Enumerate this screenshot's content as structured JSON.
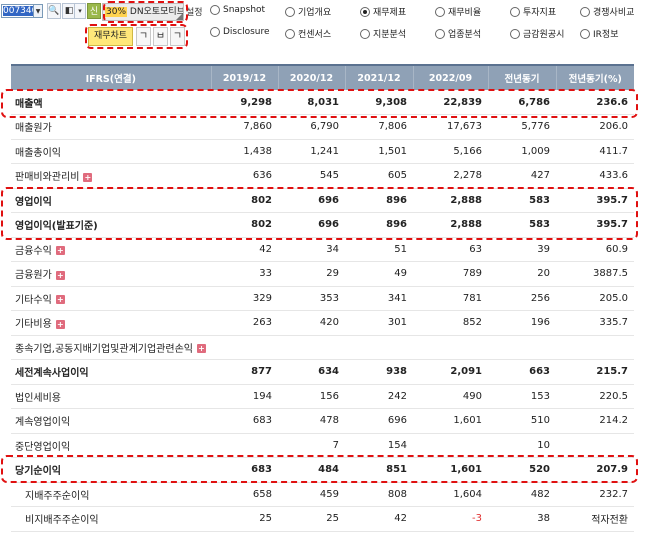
{
  "toolbar": {
    "stock_code": "007340",
    "zoom_pct": "30%",
    "stock_name": "DN오토모티브",
    "setting_label": "설정",
    "sin_label": "신",
    "fin_chart_label": "재무차트",
    "icon_buttons": [
      "ㄱ",
      "ㅂ",
      "ㄱ"
    ]
  },
  "report_tabs": {
    "row1": [
      {
        "label": "Snapshot",
        "selected": false
      },
      {
        "label": "기업개요",
        "selected": false
      },
      {
        "label": "재무제표",
        "selected": true
      },
      {
        "label": "재무비율",
        "selected": false
      },
      {
        "label": "투자지표",
        "selected": false
      },
      {
        "label": "경쟁사비교",
        "selected": false
      }
    ],
    "row2": [
      {
        "label": "Disclosure",
        "selected": false
      },
      {
        "label": "컨센서스",
        "selected": false
      },
      {
        "label": "지분분석",
        "selected": false
      },
      {
        "label": "업종분석",
        "selected": false
      },
      {
        "label": "금감원공시",
        "selected": false
      },
      {
        "label": "IR정보",
        "selected": false
      }
    ]
  },
  "table": {
    "headers": [
      "IFRS(연결)",
      "2019/12",
      "2020/12",
      "2021/12",
      "2022/09",
      "전년동기",
      "전년동기(%)"
    ],
    "rows": [
      {
        "label": "매출액",
        "values": [
          "9,298",
          "8,031",
          "9,308",
          "22,839",
          "6,786",
          "236.6"
        ],
        "bold": true,
        "expand": false,
        "sub": false
      },
      {
        "label": "매출원가",
        "values": [
          "7,860",
          "6,790",
          "7,806",
          "17,673",
          "5,776",
          "206.0"
        ],
        "bold": false,
        "expand": false,
        "sub": false
      },
      {
        "label": "매출총이익",
        "values": [
          "1,438",
          "1,241",
          "1,501",
          "5,166",
          "1,009",
          "411.7"
        ],
        "bold": false,
        "expand": false,
        "sub": false
      },
      {
        "label": "판매비와관리비",
        "values": [
          "636",
          "545",
          "605",
          "2,278",
          "427",
          "433.6"
        ],
        "bold": false,
        "expand": true,
        "sub": false
      },
      {
        "label": "영업이익",
        "values": [
          "802",
          "696",
          "896",
          "2,888",
          "583",
          "395.7"
        ],
        "bold": true,
        "expand": false,
        "sub": false
      },
      {
        "label": "영업이익(발표기준)",
        "values": [
          "802",
          "696",
          "896",
          "2,888",
          "583",
          "395.7"
        ],
        "bold": true,
        "expand": false,
        "sub": false
      },
      {
        "label": "금융수익",
        "values": [
          "42",
          "34",
          "51",
          "63",
          "39",
          "60.9"
        ],
        "bold": false,
        "expand": true,
        "sub": false
      },
      {
        "label": "금융원가",
        "values": [
          "33",
          "29",
          "49",
          "789",
          "20",
          "3887.5"
        ],
        "bold": false,
        "expand": true,
        "sub": false
      },
      {
        "label": "기타수익",
        "values": [
          "329",
          "353",
          "341",
          "781",
          "256",
          "205.0"
        ],
        "bold": false,
        "expand": true,
        "sub": false
      },
      {
        "label": "기타비용",
        "values": [
          "263",
          "420",
          "301",
          "852",
          "196",
          "335.7"
        ],
        "bold": false,
        "expand": true,
        "sub": false
      },
      {
        "label": "종속기업,공동지배기업및관계기업관련손익",
        "values": [
          "",
          "",
          "",
          "",
          "",
          ""
        ],
        "bold": false,
        "expand": true,
        "sub": false
      },
      {
        "label": "세전계속사업이익",
        "values": [
          "877",
          "634",
          "938",
          "2,091",
          "663",
          "215.7"
        ],
        "bold": true,
        "expand": false,
        "sub": false
      },
      {
        "label": "법인세비용",
        "values": [
          "194",
          "156",
          "242",
          "490",
          "153",
          "220.5"
        ],
        "bold": false,
        "expand": false,
        "sub": false
      },
      {
        "label": "계속영업이익",
        "values": [
          "683",
          "478",
          "696",
          "1,601",
          "510",
          "214.2"
        ],
        "bold": false,
        "expand": false,
        "sub": false
      },
      {
        "label": "중단영업이익",
        "values": [
          "",
          "7",
          "154",
          "",
          "10",
          ""
        ],
        "bold": false,
        "expand": false,
        "sub": false
      },
      {
        "label": "당기순이익",
        "values": [
          "683",
          "484",
          "851",
          "1,601",
          "520",
          "207.9"
        ],
        "bold": true,
        "expand": false,
        "sub": false
      },
      {
        "label": "지배주주순이익",
        "values": [
          "658",
          "459",
          "808",
          "1,604",
          "482",
          "232.7"
        ],
        "bold": false,
        "expand": false,
        "sub": true
      },
      {
        "label": "비지배주주순이익",
        "values": [
          "25",
          "25",
          "42",
          "-3",
          "38",
          "적자전환"
        ],
        "bold": false,
        "expand": false,
        "sub": true
      }
    ]
  },
  "colors": {
    "header_bg": "#8fa1b6",
    "highlight_dash": "#e01010",
    "negative_value": "#e03030",
    "expand_icon": "#e06b7d",
    "fin_chart_btn": "#ffe87a"
  }
}
